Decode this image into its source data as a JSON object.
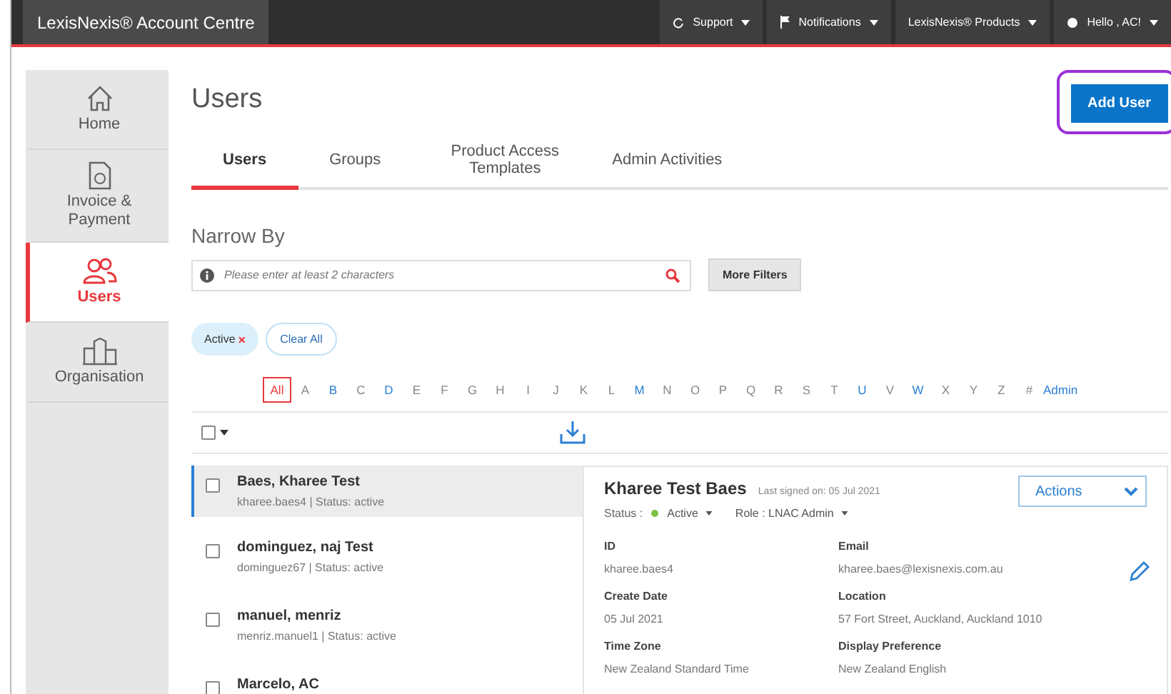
{
  "topbar": {
    "title": "LexisNexis® Account Centre",
    "menus": [
      {
        "kind": "support",
        "label": "Support"
      },
      {
        "kind": "flag",
        "label": "Notifications"
      },
      {
        "kind": "plain",
        "label": "LexisNexis® Products"
      },
      {
        "kind": "user",
        "label": "Hello , AC!"
      }
    ]
  },
  "sidebar": {
    "items": [
      {
        "kind": "home",
        "label": "Home",
        "selected": false
      },
      {
        "kind": "invoice",
        "label": "Invoice & Payment",
        "selected": false
      },
      {
        "kind": "users",
        "label": "Users",
        "selected": true
      },
      {
        "kind": "organisation",
        "label": "Organisation",
        "selected": false
      }
    ]
  },
  "page": {
    "title": "Users",
    "add_button": "Add User",
    "add_button_highlighted": true
  },
  "tabs": [
    {
      "label": "Users",
      "selected": true
    },
    {
      "label": "Groups",
      "selected": false
    },
    {
      "label": "Product Access Templates",
      "selected": false
    },
    {
      "label": "Admin Activities",
      "selected": false
    }
  ],
  "narrow_by": {
    "heading": "Narrow By",
    "search": {
      "placeholder": "Please enter at least 2 characters"
    },
    "more_filters": "More Filters"
  },
  "chips": [
    {
      "kind": "filter",
      "label": "Active",
      "remove": "×"
    },
    {
      "kind": "clear",
      "label": "Clear All"
    }
  ],
  "alphabet": [
    {
      "label": "All",
      "selected": true,
      "available": true
    },
    {
      "label": "A",
      "selected": false,
      "available": false
    },
    {
      "label": "B",
      "selected": false,
      "available": true
    },
    {
      "label": "C",
      "selected": false,
      "available": false
    },
    {
      "label": "D",
      "selected": false,
      "available": true
    },
    {
      "label": "E",
      "selected": false,
      "available": false
    },
    {
      "label": "F",
      "selected": false,
      "available": false
    },
    {
      "label": "G",
      "selected": false,
      "available": false
    },
    {
      "label": "H",
      "selected": false,
      "available": false
    },
    {
      "label": "I",
      "selected": false,
      "available": false
    },
    {
      "label": "J",
      "selected": false,
      "available": false
    },
    {
      "label": "K",
      "selected": false,
      "available": false
    },
    {
      "label": "L",
      "selected": false,
      "available": false
    },
    {
      "label": "M",
      "selected": false,
      "available": true
    },
    {
      "label": "N",
      "selected": false,
      "available": false
    },
    {
      "label": "O",
      "selected": false,
      "available": false
    },
    {
      "label": "P",
      "selected": false,
      "available": false
    },
    {
      "label": "Q",
      "selected": false,
      "available": false
    },
    {
      "label": "R",
      "selected": false,
      "available": false
    },
    {
      "label": "S",
      "selected": false,
      "available": false
    },
    {
      "label": "T",
      "selected": false,
      "available": false
    },
    {
      "label": "U",
      "selected": false,
      "available": true
    },
    {
      "label": "V",
      "selected": false,
      "available": false
    },
    {
      "label": "W",
      "selected": false,
      "available": true
    },
    {
      "label": "X",
      "selected": false,
      "available": false
    },
    {
      "label": "Y",
      "selected": false,
      "available": false
    },
    {
      "label": "Z",
      "selected": false,
      "available": false
    },
    {
      "label": "#",
      "selected": false,
      "available": false
    },
    {
      "label": "Admin",
      "selected": false,
      "available": true
    }
  ],
  "select_all": {
    "checked": false
  },
  "users": [
    {
      "name": "Baes, Kharee Test",
      "meta": "kharee.baes4 | Status: active",
      "selected": true,
      "checked": false
    },
    {
      "name": "dominguez, naj Test",
      "meta": "dominguez67 | Status: active",
      "selected": false,
      "checked": false
    },
    {
      "name": "manuel, menriz",
      "meta": "menriz.manuel1 | Status: active",
      "selected": false,
      "checked": false
    },
    {
      "name": "Marcelo, AC",
      "selected": false,
      "checked": false
    }
  ],
  "detail": {
    "name": "Kharee Test Baes",
    "last_signed": "Last signed on: 05 Jul 2021",
    "actions": "Actions",
    "status_label": "Status :",
    "status": "Active",
    "status_on": true,
    "role": "Role : LNAC Admin",
    "fields": [
      {
        "label": "ID",
        "value": "kharee.baes4"
      },
      {
        "label": "Email",
        "value": "kharee.baes@lexisnexis.com.au"
      },
      {
        "label": "Create Date",
        "value": "05 Jul 2021"
      },
      {
        "label": "Location",
        "value": "57 Fort Street, Auckland, Auckland 1010"
      },
      {
        "label": "Time Zone",
        "value": "New Zealand Standard Time"
      },
      {
        "label": "Display Preference",
        "value": "New Zealand English"
      }
    ]
  }
}
